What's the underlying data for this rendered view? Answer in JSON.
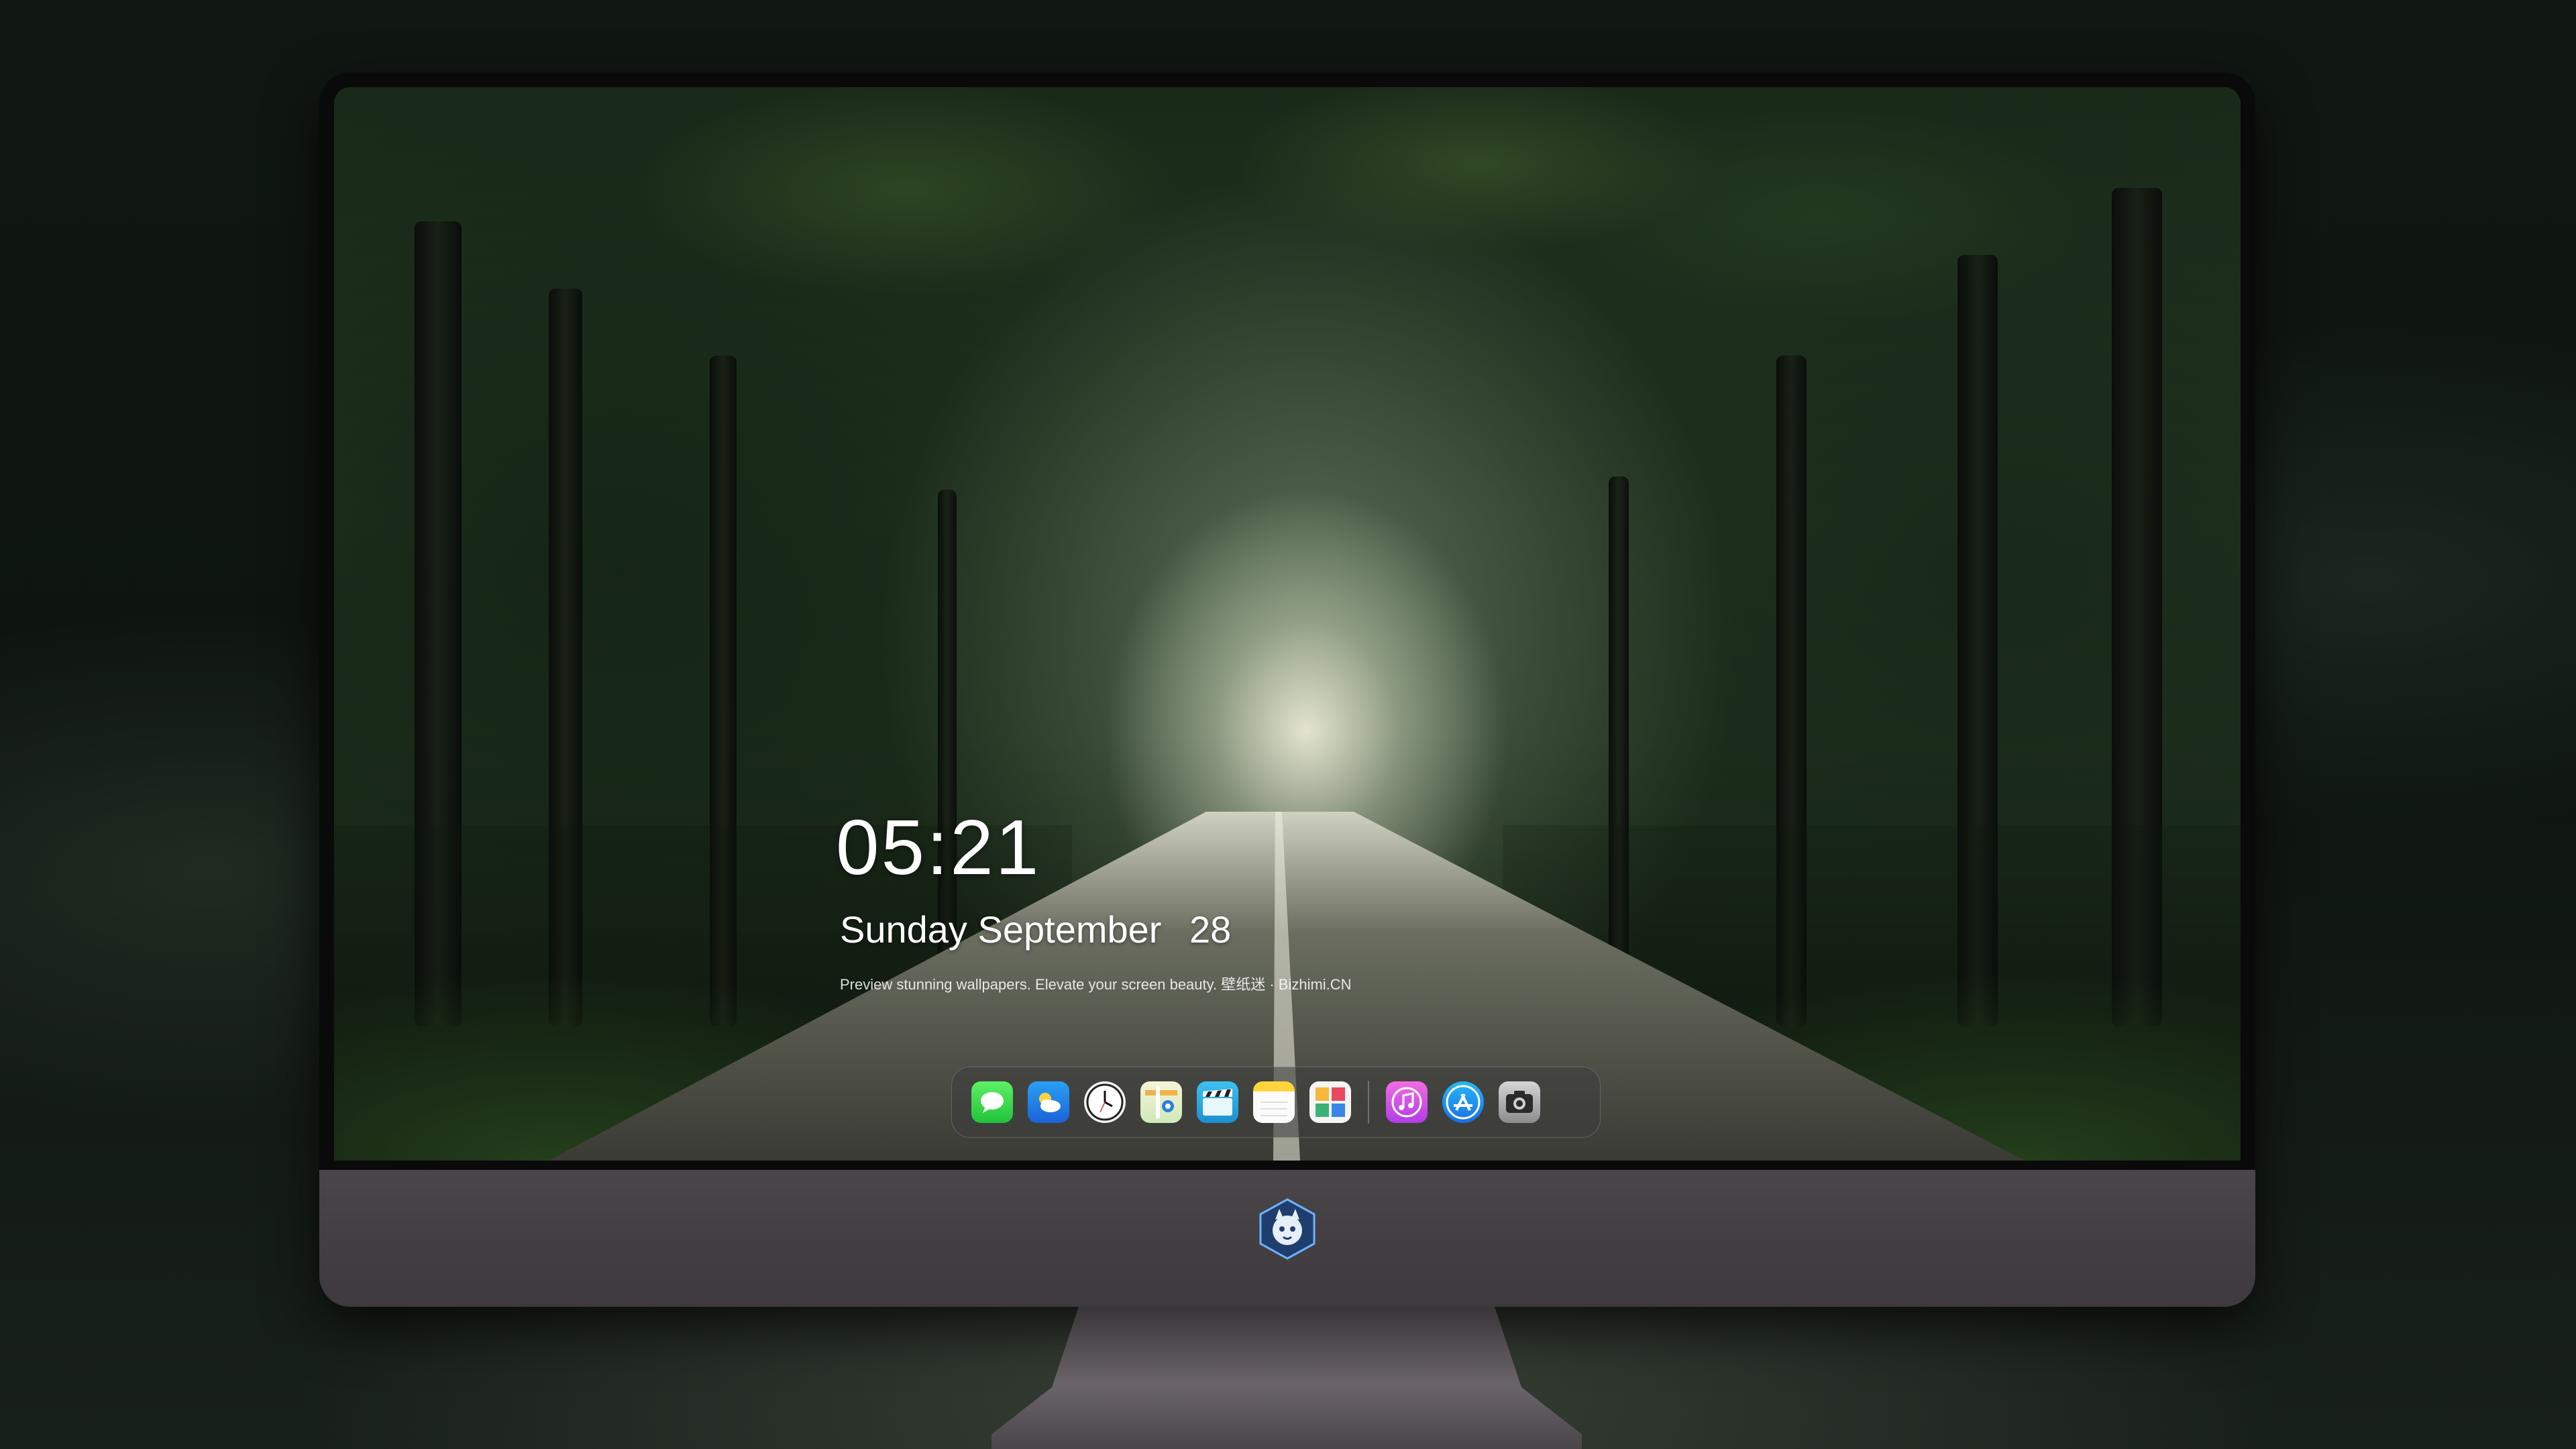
{
  "lockscreen": {
    "time": "05:21",
    "weekday": "Sunday",
    "month": "September",
    "day": "28",
    "tagline": "Preview stunning wallpapers. Elevate your screen beauty. 壁纸迷 · Bizhimi.CN"
  },
  "dock": {
    "apps": [
      {
        "name": "messages",
        "icon": "message-bubble-icon"
      },
      {
        "name": "weather",
        "icon": "cloud-sun-icon"
      },
      {
        "name": "clock",
        "icon": "clock-icon"
      },
      {
        "name": "maps",
        "icon": "map-icon"
      },
      {
        "name": "clips",
        "icon": "clapperboard-icon"
      },
      {
        "name": "notes",
        "icon": "notes-icon"
      },
      {
        "name": "photos",
        "icon": "gallery-icon"
      },
      {
        "name": "music",
        "icon": "music-note-icon"
      },
      {
        "name": "app-store",
        "icon": "app-store-icon"
      },
      {
        "name": "camera",
        "icon": "camera-icon"
      }
    ]
  },
  "monitor": {
    "logo": "mascot-logo-icon"
  },
  "colors": {
    "page_bg": "#0c120e",
    "chin": "#4a4549",
    "bezel": "#0a0a0a",
    "text": "#ffffff"
  }
}
